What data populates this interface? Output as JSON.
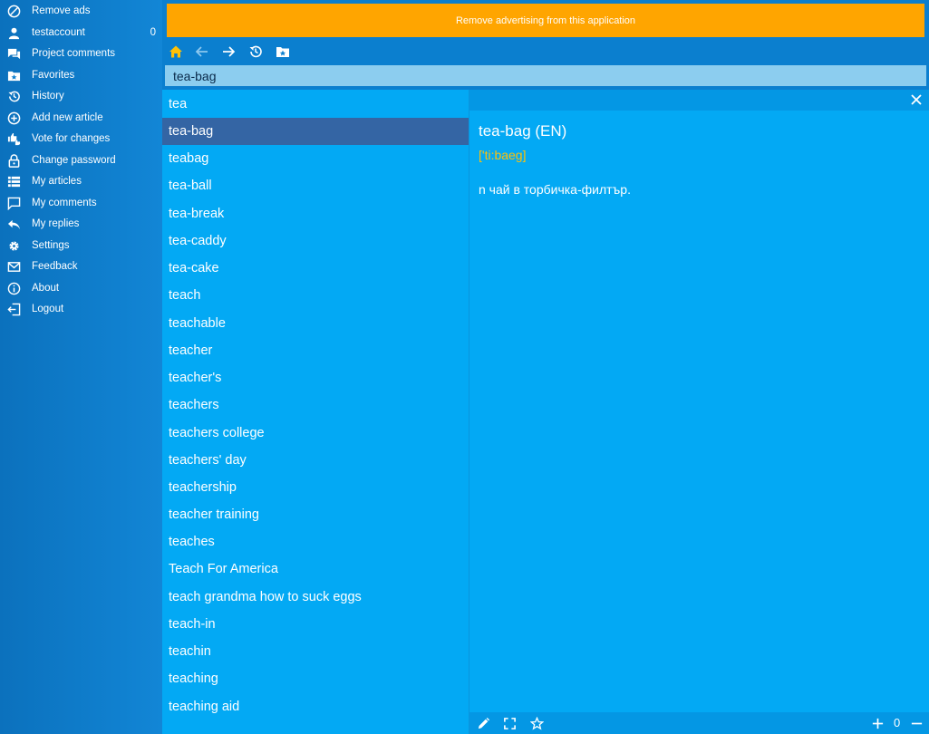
{
  "sidebar": {
    "items": [
      {
        "label": "Remove ads",
        "icon": "block-icon"
      },
      {
        "label": "testaccount",
        "icon": "user-icon",
        "count": "0"
      },
      {
        "label": "Project comments",
        "icon": "comments-icon"
      },
      {
        "label": "Favorites",
        "icon": "folder-star-icon"
      },
      {
        "label": "History",
        "icon": "history-icon"
      },
      {
        "label": "Add new article",
        "icon": "plus-circle-icon"
      },
      {
        "label": "Vote for changes",
        "icon": "thumbs-icon"
      },
      {
        "label": "Change password",
        "icon": "lock-icon"
      },
      {
        "label": "My articles",
        "icon": "list-icon"
      },
      {
        "label": "My comments",
        "icon": "comment-icon"
      },
      {
        "label": "My replies",
        "icon": "reply-icon"
      },
      {
        "label": "Settings",
        "icon": "gear-icon"
      },
      {
        "label": "Feedback",
        "icon": "mail-icon"
      },
      {
        "label": "About",
        "icon": "info-icon"
      },
      {
        "label": "Logout",
        "icon": "logout-icon"
      }
    ]
  },
  "banner": {
    "text": "Remove advertising from this application",
    "color": "#ffa500"
  },
  "toolbar": {
    "icons": [
      "home-icon",
      "back-icon",
      "forward-icon",
      "history-icon",
      "folder-star-icon"
    ]
  },
  "search": {
    "value": "tea-bag"
  },
  "word_list": {
    "selected_index": 1,
    "items": [
      "tea",
      "tea-bag",
      "teabag",
      "tea-ball",
      "tea-break",
      "tea-caddy",
      "tea-cake",
      "teach",
      "teachable",
      "teacher",
      "teacher's",
      "teachers",
      "teachers college",
      "teachers' day",
      "teachership",
      "teacher training",
      "teaches",
      "Teach For America",
      "teach grandma how to suck eggs",
      "teach-in",
      "teachin",
      "teaching",
      "teaching aid"
    ]
  },
  "article": {
    "title": "tea-bag (EN)",
    "transcription": "['ti:baeg]",
    "body": "n чай в торбичка-филтър."
  },
  "bottom_bar": {
    "icons": [
      "edit-icon",
      "fullscreen-icon",
      "star-icon",
      "plus-icon",
      "minus-icon"
    ],
    "zoom": "0"
  },
  "colors": {
    "accent": "#03a9f4",
    "selected": "#3465a4",
    "transcription": "#ffc107",
    "home": "#ffc107"
  }
}
